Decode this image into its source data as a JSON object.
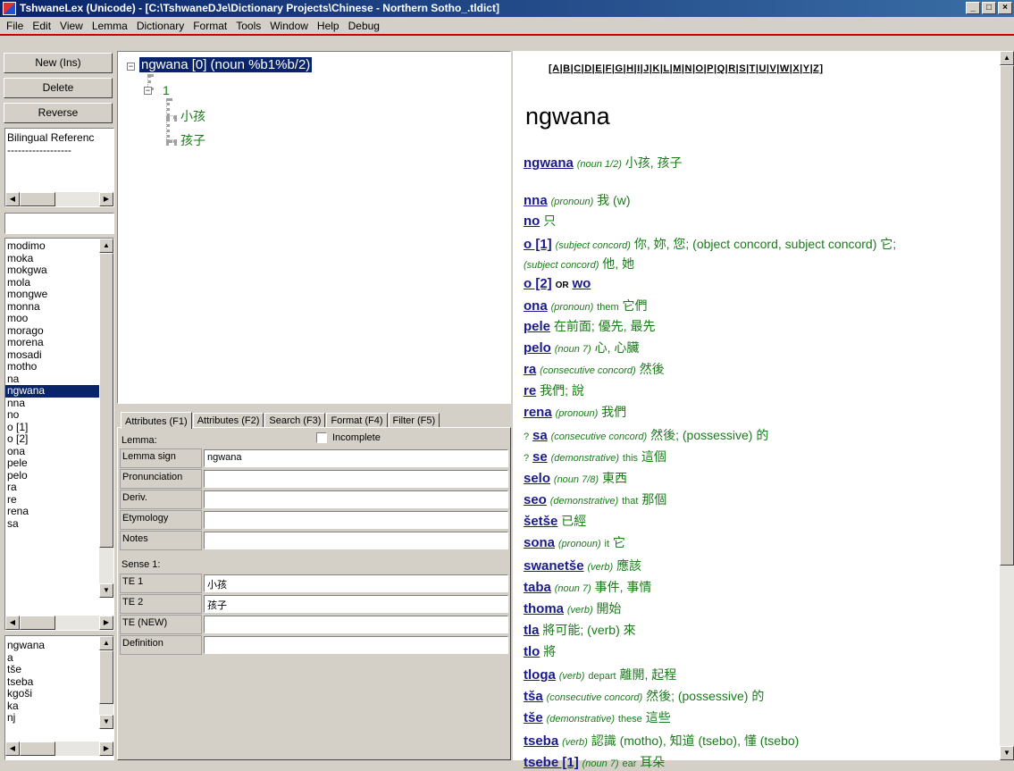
{
  "window": {
    "title": "TshwaneLex (Unicode) - [C:\\TshwaneDJe\\Dictionary Projects\\Chinese - Northern Sotho_.tldict]",
    "buttons": [
      "_",
      "□",
      "×"
    ]
  },
  "menu": [
    "File",
    "Edit",
    "View",
    "Lemma",
    "Dictionary",
    "Format",
    "Tools",
    "Window",
    "Help",
    "Debug"
  ],
  "left": {
    "new_label": "New (Ins)",
    "delete_label": "Delete",
    "reverse_label": "Reverse",
    "bilingual_label": "Bilingual Referenc",
    "bilingual_sep": "------------------",
    "search_value": "",
    "lemma_list": [
      "modimo",
      "moka",
      "mokgwa",
      "mola",
      "mongwe",
      "monna",
      "moo",
      "morago",
      "morena",
      "mosadi",
      "motho",
      "na",
      "ngwana",
      "nna",
      "no",
      "o [1]",
      "o [2]",
      "ona",
      "pele",
      "pelo",
      "ra",
      "re",
      "rena",
      "sa"
    ],
    "selected_index": 12,
    "ref_list": [
      "ngwana",
      "a",
      "tše",
      "tseba",
      "kgoši",
      "ka",
      "nj"
    ]
  },
  "tree": {
    "root": "ngwana [0] (noun %b1%b/2)",
    "sense": "1",
    "te1": "小孩",
    "te2": "孩子",
    "expander": "−"
  },
  "tabs": [
    "Attributes (F1)",
    "Attributes (F2)",
    "Search (F3)",
    "Format (F4)",
    "Filter (F5)"
  ],
  "attributes": {
    "lemma_label": "Lemma:",
    "incomplete_label": "Incomplete",
    "fields": [
      {
        "label": "Lemma sign",
        "value": "ngwana"
      },
      {
        "label": "Pronunciation",
        "value": ""
      },
      {
        "label": "Deriv.",
        "value": ""
      },
      {
        "label": "Etymology",
        "value": ""
      },
      {
        "label": "Notes",
        "value": ""
      }
    ],
    "sense_label": "Sense 1:",
    "sense_fields": [
      {
        "label": "TE 1",
        "value": "小孩"
      },
      {
        "label": "TE 2",
        "value": "孩子"
      },
      {
        "label": "TE (NEW)",
        "value": ""
      },
      {
        "label": "Definition",
        "value": ""
      }
    ]
  },
  "preview": {
    "alphabet": "[A|B|C|D|E|F|G|H|I|J|K|L|M|N|O|P|Q|R|S|T|U|V|W|X|Y|Z]",
    "headword": "ngwana",
    "main_entry": {
      "hw": "ngwana",
      "pos": "(noun 1/2)",
      "text": "小孩, 孩子"
    },
    "entries": [
      {
        "q": "",
        "hw": "nna",
        "pos": "(pronoun)",
        "eng": "",
        "text": "我 (w)"
      },
      {
        "q": "",
        "hw": "no",
        "pos": "",
        "eng": "",
        "text": "只"
      },
      {
        "q": "",
        "hw": "o [1]",
        "pos": "(subject concord)",
        "eng": "",
        "text": "你, 妳, 您; (object concord, subject concord) 它;"
      },
      {
        "q": "",
        "hw": "",
        "pos": "(subject concord)",
        "eng": "",
        "text": "他, 她"
      },
      {
        "q": "",
        "hw": "o [2]",
        "pos": "",
        "eng": "",
        "text": "",
        "or": "OR",
        "orword": "wo"
      },
      {
        "q": "",
        "hw": "ona",
        "pos": "(pronoun)",
        "eng": "them",
        "text": "它們"
      },
      {
        "q": "",
        "hw": "pele",
        "pos": "",
        "eng": "",
        "text": "在前面; 優先, 最先"
      },
      {
        "q": "",
        "hw": "pelo",
        "pos": "(noun 7)",
        "eng": "",
        "text": "心, 心臟"
      },
      {
        "q": "",
        "hw": "ra",
        "pos": "(consecutive concord)",
        "eng": "",
        "text": "然後"
      },
      {
        "q": "",
        "hw": "re",
        "pos": "",
        "eng": "",
        "text": "我們; 說"
      },
      {
        "q": "",
        "hw": "rena",
        "pos": "(pronoun)",
        "eng": "",
        "text": "我們"
      },
      {
        "q": "?",
        "hw": "sa",
        "pos": "(consecutive concord)",
        "eng": "",
        "text": "然後; (possessive) 的"
      },
      {
        "q": "?",
        "hw": "se",
        "pos": "(demonstrative)",
        "eng": "this",
        "text": "這個"
      },
      {
        "q": "",
        "hw": "selo",
        "pos": "(noun 7/8)",
        "eng": "",
        "text": "東西"
      },
      {
        "q": "",
        "hw": "seo",
        "pos": "(demonstrative)",
        "eng": "that",
        "text": "那個"
      },
      {
        "q": "",
        "hw": "šetše",
        "pos": "",
        "eng": "",
        "text": "已經"
      },
      {
        "q": "",
        "hw": "sona",
        "pos": "(pronoun)",
        "eng": "it",
        "text": "它"
      },
      {
        "q": "",
        "hw": "swanetše",
        "pos": "(verb)",
        "eng": "",
        "text": "應該"
      },
      {
        "q": "",
        "hw": "taba",
        "pos": "(noun 7)",
        "eng": "",
        "text": "事件, 事情"
      },
      {
        "q": "",
        "hw": "thoma",
        "pos": "(verb)",
        "eng": "",
        "text": "開始"
      },
      {
        "q": "",
        "hw": "tla",
        "pos": "",
        "eng": "",
        "text": "將可能; (verb) 來"
      },
      {
        "q": "",
        "hw": "tlo",
        "pos": "",
        "eng": "",
        "text": "將"
      },
      {
        "q": "",
        "hw": "tloga",
        "pos": "(verb)",
        "eng": "depart",
        "text": "離開, 起程"
      },
      {
        "q": "",
        "hw": "tša",
        "pos": "(consecutive concord)",
        "eng": "",
        "text": "然後; (possessive) 的"
      },
      {
        "q": "",
        "hw": "tše",
        "pos": "(demonstrative)",
        "eng": "these",
        "text": "這些"
      },
      {
        "q": "",
        "hw": "tseba",
        "pos": "(verb)",
        "eng": "",
        "text": "認識 (motho), 知道 (tsebo), 懂 (tsebo)"
      },
      {
        "q": "",
        "hw": "tsebe [1]",
        "pos": "(noun 7)",
        "eng": "ear",
        "text": "耳朵"
      }
    ]
  }
}
